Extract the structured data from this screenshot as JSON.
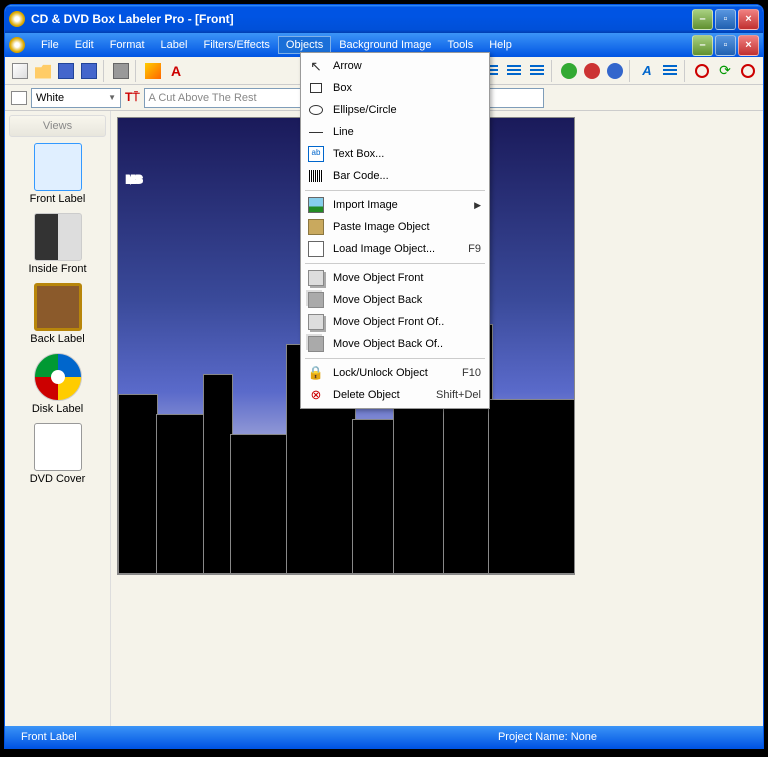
{
  "title": "CD & DVD Box Labeler Pro - [Front]",
  "menubar": [
    "File",
    "Edit",
    "Format",
    "Label",
    "Filters/Effects",
    "Objects",
    "Background Image",
    "Tools",
    "Help"
  ],
  "active_menu_index": 5,
  "toolbar2": {
    "color_name": "White",
    "font_placeholder": "A Cut Above The Rest"
  },
  "sidebar": {
    "header": "Views",
    "items": [
      {
        "label": "Front Label",
        "selected": true
      },
      {
        "label": "Inside Front",
        "selected": false
      },
      {
        "label": "Back Label",
        "selected": false
      },
      {
        "label": "Disk Label",
        "selected": false
      },
      {
        "label": "DVD Cover",
        "selected": false
      }
    ]
  },
  "canvas_text": "MUS",
  "dropdown": {
    "items": [
      {
        "icon": "arrow",
        "label": "Arrow",
        "shortcut": "",
        "submenu": false
      },
      {
        "icon": "box",
        "label": "Box",
        "shortcut": "",
        "submenu": false
      },
      {
        "icon": "ellipse",
        "label": "Ellipse/Circle",
        "shortcut": "",
        "submenu": false
      },
      {
        "icon": "line",
        "label": "Line",
        "shortcut": "",
        "submenu": false
      },
      {
        "icon": "text",
        "label": "Text Box...",
        "shortcut": "",
        "submenu": false
      },
      {
        "icon": "barcode",
        "label": "Bar Code...",
        "shortcut": "",
        "submenu": false
      },
      {
        "sep": true
      },
      {
        "icon": "img",
        "label": "Import Image",
        "shortcut": "",
        "submenu": true
      },
      {
        "icon": "paste",
        "label": "Paste Image Object",
        "shortcut": "",
        "submenu": false
      },
      {
        "icon": "load",
        "label": "Load Image Object...",
        "shortcut": "F9",
        "submenu": false
      },
      {
        "sep": true
      },
      {
        "icon": "front",
        "label": "Move Object Front",
        "shortcut": "",
        "submenu": false
      },
      {
        "icon": "back",
        "label": "Move Object Back",
        "shortcut": "",
        "submenu": false
      },
      {
        "icon": "front",
        "label": "Move Object Front Of..",
        "shortcut": "",
        "submenu": false
      },
      {
        "icon": "back",
        "label": "Move Object Back Of..",
        "shortcut": "",
        "submenu": false
      },
      {
        "sep": true
      },
      {
        "icon": "lock",
        "label": "Lock/Unlock Object",
        "shortcut": "F10",
        "submenu": false
      },
      {
        "icon": "del",
        "label": "Delete Object",
        "shortcut": "Shift+Del",
        "submenu": false
      }
    ]
  },
  "statusbar": {
    "left": "Front Label",
    "project": "Project Name: None"
  }
}
